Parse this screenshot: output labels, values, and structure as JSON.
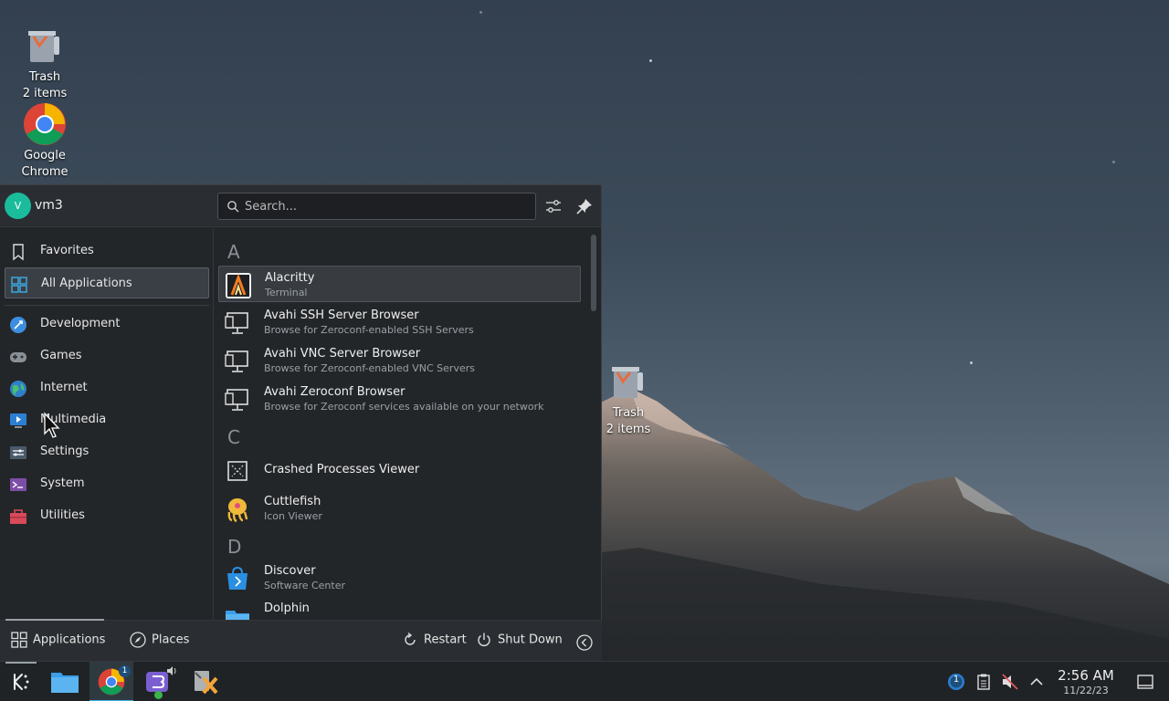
{
  "desktop": {
    "icons": [
      {
        "name": "Trash",
        "sub": "2 items"
      },
      {
        "name": "Google",
        "sub": "Chrome"
      },
      {
        "name": "Trash",
        "sub": "2 items"
      }
    ]
  },
  "launcher": {
    "user": {
      "initial": "V",
      "name": "vm3"
    },
    "search": {
      "placeholder": "Search..."
    },
    "categories": [
      {
        "label": "Favorites"
      },
      {
        "label": "All Applications"
      },
      {
        "label": "Development"
      },
      {
        "label": "Games"
      },
      {
        "label": "Internet"
      },
      {
        "label": "Multimedia"
      },
      {
        "label": "Settings"
      },
      {
        "label": "System"
      },
      {
        "label": "Utilities"
      }
    ],
    "sections": [
      "A",
      "C",
      "D"
    ],
    "apps": [
      {
        "name": "Alacritty",
        "desc": "Terminal"
      },
      {
        "name": "Avahi SSH Server Browser",
        "desc": "Browse for Zeroconf-enabled SSH Servers"
      },
      {
        "name": "Avahi VNC Server Browser",
        "desc": "Browse for Zeroconf-enabled VNC Servers"
      },
      {
        "name": "Avahi Zeroconf Browser",
        "desc": "Browse for Zeroconf services available on your network"
      },
      {
        "name": "Crashed Processes Viewer",
        "desc": ""
      },
      {
        "name": "Cuttlefish",
        "desc": "Icon Viewer"
      },
      {
        "name": "Discover",
        "desc": "Software Center"
      },
      {
        "name": "Dolphin",
        "desc": ""
      }
    ],
    "footer": {
      "applications": "Applications",
      "places": "Places",
      "restart": "Restart",
      "shutdown": "Shut Down"
    }
  },
  "taskbar": {
    "chrome_badge": "1",
    "updates_badge": "1",
    "time": "2:56 AM",
    "date": "11/22/23"
  },
  "colors": {
    "accent_avatar": "#1abc9c",
    "panel_bg": "#232629",
    "taskbar_bg": "#202326"
  }
}
